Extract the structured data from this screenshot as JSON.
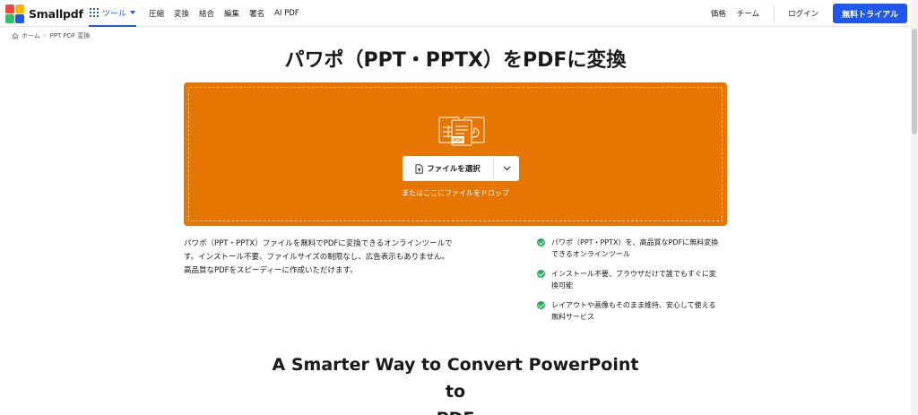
{
  "header": {
    "brand": "Smallpdf",
    "tools_label": "ツール",
    "nav": [
      "圧縮",
      "変換",
      "結合",
      "編集",
      "署名",
      "AI PDF"
    ],
    "pricing": "価格",
    "team": "チーム",
    "login": "ログイン",
    "trial": "無料トライアル",
    "brand_colors": [
      "#f04a3e",
      "#ffb400",
      "#2ec26b",
      "#1f58ef"
    ],
    "accent_color": "#1f58ef"
  },
  "breadcrumb": {
    "home": "ホーム",
    "current": "PPT PDF 変換",
    "icon": "home-icon"
  },
  "title": "パワポ（PPT・PPTX）をPDFに変換",
  "upload": {
    "choose_label": "ファイルを選択",
    "drop_text": "またはここにファイルをドロップ",
    "pdf_badge": "PDF",
    "bg_color": "#e67600",
    "icons": [
      "documents-icon",
      "file-upload-icon",
      "chevron-down-icon"
    ]
  },
  "description": [
    "パワポ（PPT・PPTX）ファイルを無料でPDFに変換できるオンラインツールで",
    "す。インストール不要、ファイルサイズの制限なし、広告表示もありません。",
    "高品質なPDFをスピーディーに作成いただけます。"
  ],
  "features": [
    {
      "lines": [
        "パワポ（PPT・PPTX）を、高品質なPDFに無料変換",
        "できるオンラインツール"
      ]
    },
    {
      "lines": [
        "インストール不要、ブラウザだけで誰でもすぐに変",
        "換可能"
      ]
    },
    {
      "lines": [
        "レイアウトや画像もそのまま維持、安心して使える",
        "無料サービス"
      ]
    }
  ],
  "check_color": "#21b25a",
  "subtitle": [
    "A Smarter Way to Convert PowerPoint to",
    "PDF"
  ]
}
